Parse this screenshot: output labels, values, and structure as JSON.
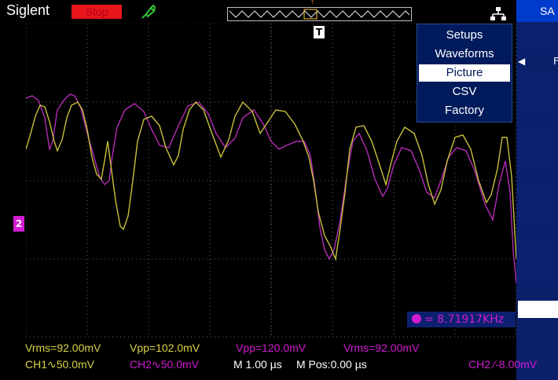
{
  "header": {
    "brand": "Siglent",
    "run_status": "Stop",
    "trigger_marker": "T"
  },
  "colors": {
    "ch1": "#d9d247",
    "ch2": "#d21bd2",
    "stop": "#e8151b",
    "menu_bg": "#001a5c",
    "side_panel": "#0b1f6b"
  },
  "icons": {
    "probe": "probe-icon",
    "network": "network-icon",
    "trigger": "trigger-marker-icon",
    "channel": "ch2-ground-marker-icon"
  },
  "menu": {
    "items": [
      {
        "label": "Setups",
        "selected": false
      },
      {
        "label": "Waveforms",
        "selected": false
      },
      {
        "label": "Picture",
        "selected": true
      },
      {
        "label": "CSV",
        "selected": false
      },
      {
        "label": "Factory",
        "selected": false
      }
    ]
  },
  "side_panel": {
    "title": "SA",
    "item_label": "F"
  },
  "screen": {
    "frequency": "= 8.71917KHz",
    "ch_marker": "2"
  },
  "measurements": {
    "row1": [
      {
        "text": "Vrms=92.00mV",
        "ch": "ch1"
      },
      {
        "text": "Vpp=102.0mV",
        "ch": "ch1"
      },
      {
        "text": "Vpp=120.0mV",
        "ch": "ch2"
      },
      {
        "text": "Vrms=92.00mV",
        "ch": "ch2"
      }
    ],
    "row2": {
      "ch1": "CH1∿50.0mV",
      "ch2": "CH2∿50.0mV",
      "timebase": "M 1.00 µs",
      "mpos": "M Pos:0.00 µs",
      "trigger": "CH2 ∕-8.00mV"
    }
  }
}
